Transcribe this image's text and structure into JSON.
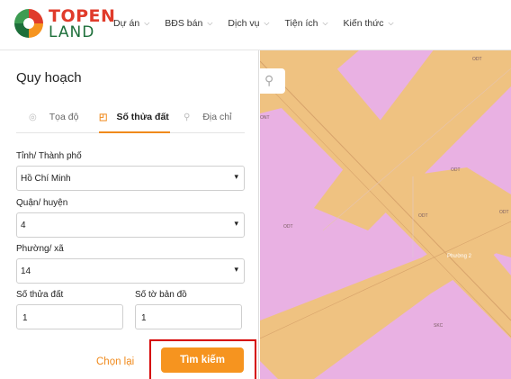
{
  "brand": {
    "logo_top": "TOPEN",
    "logo_bottom": "LAND",
    "colors": {
      "red": "#e03b2b",
      "green": "#1d6f3a",
      "orange": "#f08a1c",
      "accent_button": "#f6941f",
      "highlight": "#d50000"
    }
  },
  "nav": [
    {
      "label": "Dự án"
    },
    {
      "label": "BĐS bán"
    },
    {
      "label": "Dịch vụ"
    },
    {
      "label": "Tiện ích"
    },
    {
      "label": "Kiến thức"
    }
  ],
  "panel": {
    "title": "Quy hoạch",
    "tabs": [
      {
        "label": "Tọa độ",
        "icon": "target-icon"
      },
      {
        "label": "Số thửa đất",
        "icon": "parcel-icon",
        "active": true
      },
      {
        "label": "Địa chỉ",
        "icon": "pin-icon"
      }
    ],
    "fields": {
      "province": {
        "label": "Tỉnh/ Thành phố",
        "value": "Hồ Chí Minh"
      },
      "district": {
        "label": "Quận/ huyện",
        "value": "4"
      },
      "ward": {
        "label": "Phường/ xã",
        "value": "14"
      },
      "parcel_no": {
        "label": "Số thửa đất",
        "value": "1"
      },
      "map_sheet_no": {
        "label": "Số tờ bản đồ",
        "value": "1"
      }
    },
    "reset_label": "Chọn lại",
    "search_label": "Tìm kiếm"
  },
  "map": {
    "labels": {
      "a": "ODT",
      "b": "ONT",
      "c": "ODT",
      "d": "ODT",
      "e": "ODT",
      "f": "ODT",
      "g": "Phường 2",
      "h": "SKC"
    },
    "colors": {
      "residential": "#e9b1e3",
      "road": "#efc281",
      "road_line": "#d7a36b"
    }
  }
}
